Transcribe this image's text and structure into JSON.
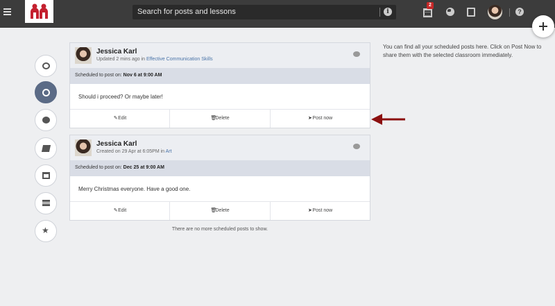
{
  "search": {
    "placeholder": "Search for posts and lessons"
  },
  "topbar": {
    "calendar_badge": "2"
  },
  "colors": {
    "accent": "#5b6b86",
    "topbar": "#3c3c3c",
    "badge": "#c62828",
    "arrow": "#8b0f0f"
  },
  "posts": [
    {
      "author": "Jessica Karl",
      "meta_prefix": "Updated 2 mins ago in ",
      "meta_group": "Effective Communication Skills",
      "schedule_prefix": "Scheduled to post on: ",
      "schedule_date": "Nov 6 at 9:00 AM",
      "body": "Should i proceed? Or maybe later!",
      "actions": {
        "edit": "Edit",
        "delete": "Delete",
        "post_now": "Post now"
      }
    },
    {
      "author": "Jessica Karl",
      "meta_prefix": "Created on 29 Apr at 6:05PM in ",
      "meta_group": "Art",
      "schedule_prefix": "Scheduled to post on: ",
      "schedule_date": "Dec 25 at 9:00 AM",
      "body": "Merry Christmas everyone. Have a good one.",
      "actions": {
        "edit": "Edit",
        "delete": "Delete",
        "post_now": "Post now"
      }
    }
  ],
  "empty_message": "There are no more scheduled posts to show.",
  "help_text": "You can find all your scheduled posts here. Click on Post Now to share them with the selected classroom immediately.",
  "sidebar": [
    "chat-dots-icon",
    "clock-icon",
    "chat-icon",
    "book-icon",
    "window-icon",
    "stack-icon",
    "star-icon"
  ]
}
